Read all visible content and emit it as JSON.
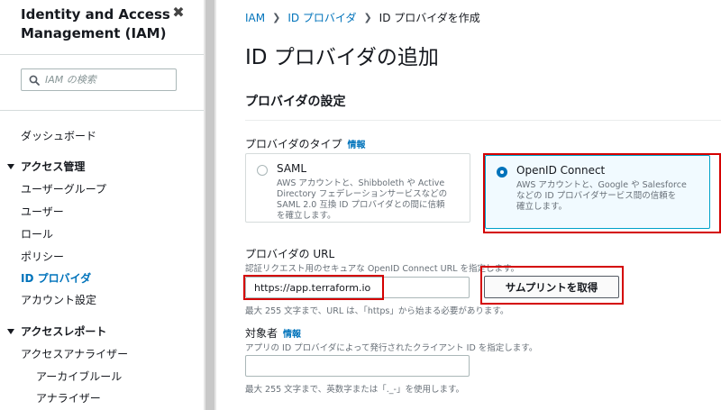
{
  "sidebar": {
    "title_line1": "Identity and Access",
    "title_line2": "Management (IAM)",
    "close_label": "✖",
    "search_placeholder": "IAM の検索",
    "dashboard": "ダッシュボード",
    "access_mgmt": {
      "label": "アクセス管理",
      "items": [
        "ユーザーグループ",
        "ユーザー",
        "ロール",
        "ポリシー",
        "ID プロバイダ",
        "アカウント設定"
      ],
      "active_index": 4
    },
    "access_reports": {
      "label": "アクセスレポート",
      "items": [
        "アクセスアナライザー",
        "アーカイブルール",
        "アナライザー"
      ]
    }
  },
  "breadcrumb": {
    "items": [
      "IAM",
      "ID プロバイダ",
      "ID プロバイダを作成"
    ],
    "separator": "❯"
  },
  "page_title": "ID プロバイダの追加",
  "section_title": "プロバイダの設定",
  "provider_type": {
    "label": "プロバイダのタイプ",
    "info": "情報",
    "options": [
      {
        "title": "SAML",
        "desc": [
          "AWS アカウントと、Shibboleth や Active",
          "Directory フェデレーションサービスなどの",
          "SAML 2.0 互換 ID プロバイダとの間に信頼",
          "を確立します。"
        ],
        "selected": false
      },
      {
        "title": "OpenID Connect",
        "desc": [
          "AWS アカウントと、Google や Salesforce",
          "などの ID プロバイダサービス間の信頼を",
          "確立します。"
        ],
        "selected": true
      }
    ]
  },
  "provider_url": {
    "label": "プロバイダの URL",
    "desc": "認証リクエスト用のセキュアな OpenID Connect URL を指定します。",
    "value": "https://app.terraform.io",
    "hint": "最大 255 文字まで、URL は、「https」から始まる必要があります。",
    "button": "サムプリントを取得"
  },
  "audience": {
    "label": "対象者",
    "info": "情報",
    "desc": "アプリの ID プロバイダによって発行されたクライアント ID を指定します。",
    "value": "",
    "hint": "最大 255 文字まで、英数字または「._-」を使用します。"
  },
  "colors": {
    "link": "#0073bb",
    "highlight": "#d40000",
    "selected_border": "#00a1c9"
  }
}
